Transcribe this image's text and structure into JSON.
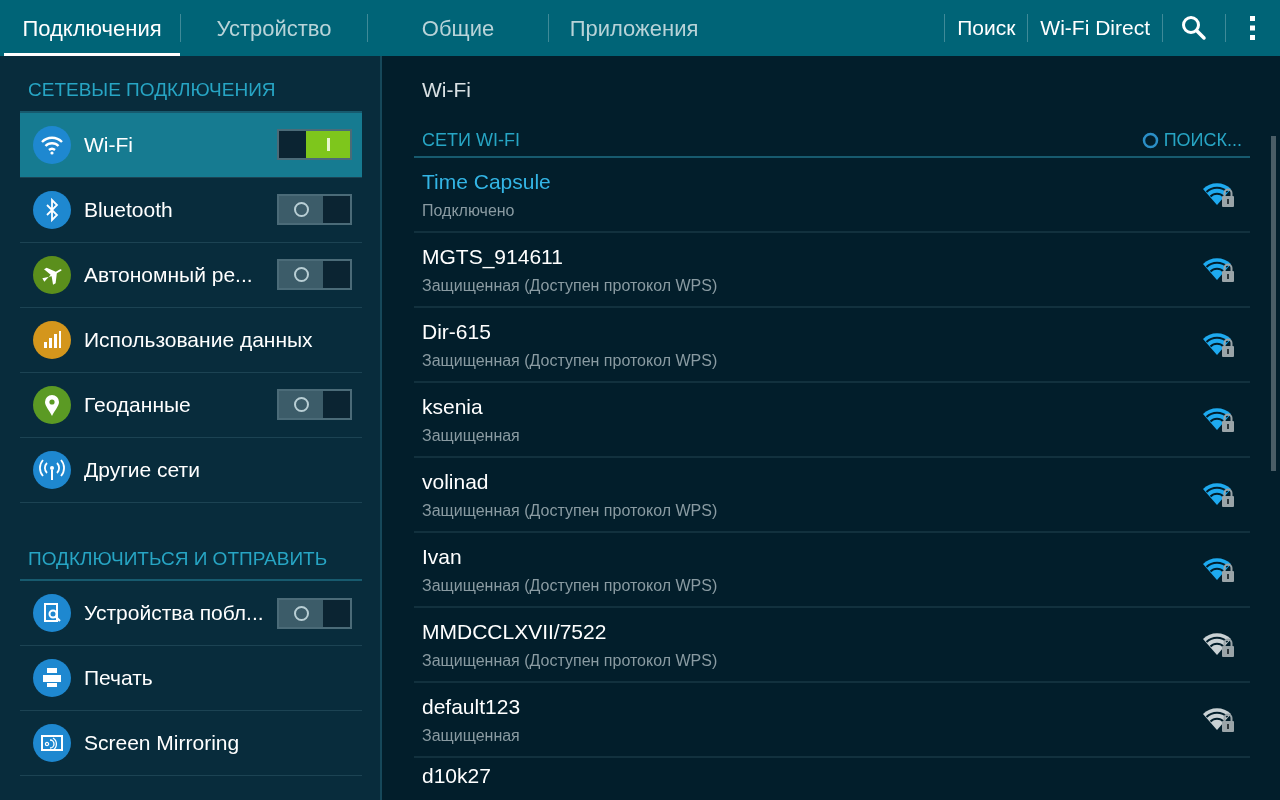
{
  "tabs": [
    {
      "label": "Подключения",
      "selected": true
    },
    {
      "label": "Устройство",
      "selected": false
    },
    {
      "label": "Общие",
      "selected": false
    },
    {
      "label": "Приложения",
      "selected": false
    }
  ],
  "actions": [
    "Поиск",
    "Wi-Fi Direct"
  ],
  "sidebar": {
    "sections": [
      {
        "title": "СЕТЕВЫЕ ПОДКЛЮЧЕНИЯ",
        "items": [
          {
            "label": "Wi-Fi",
            "kind": "wifi",
            "color": "#1e88d0",
            "selected": true,
            "toggle": true,
            "on": true
          },
          {
            "label": "Bluetooth",
            "kind": "bluetooth",
            "color": "#1e88d0",
            "selected": false,
            "toggle": true,
            "on": false
          },
          {
            "label": "Автономный ре...",
            "kind": "airplane",
            "color": "#5b8f1c",
            "selected": false,
            "toggle": true,
            "on": false
          },
          {
            "label": "Использование данных",
            "kind": "data",
            "color": "#d4961c",
            "selected": false,
            "toggle": false
          },
          {
            "label": "Геоданные",
            "kind": "location",
            "color": "#5b9a24",
            "selected": false,
            "toggle": true,
            "on": false
          },
          {
            "label": "Другие сети",
            "kind": "antenna",
            "color": "#1e88d0",
            "selected": false,
            "toggle": false
          }
        ]
      },
      {
        "title": "ПОДКЛЮЧИТЬСЯ И ОТПРАВИТЬ",
        "items": [
          {
            "label": "Устройства побл...",
            "kind": "nearby",
            "color": "#1e88d0",
            "selected": false,
            "toggle": true,
            "on": false
          },
          {
            "label": "Печать",
            "kind": "printer",
            "color": "#1e88d0",
            "selected": false,
            "toggle": false
          },
          {
            "label": "Screen Mirroring",
            "kind": "mirror",
            "color": "#1e88d0",
            "selected": false,
            "toggle": false
          }
        ]
      }
    ]
  },
  "content": {
    "title": "Wi-Fi",
    "list_header": "СЕТИ WI-FI",
    "scan_status": "ПОИСК...",
    "networks": [
      {
        "name": "Time Capsule",
        "status": "Подключено",
        "connected": true,
        "kind": "strong"
      },
      {
        "name": "MGTS_914611",
        "status": "Защищенная (Доступен протокол WPS)",
        "connected": false,
        "kind": "strong"
      },
      {
        "name": "Dir-615",
        "status": "Защищенная (Доступен протокол WPS)",
        "connected": false,
        "kind": "strong"
      },
      {
        "name": "ksenia",
        "status": "Защищенная",
        "connected": false,
        "kind": "strong"
      },
      {
        "name": "volinad",
        "status": "Защищенная (Доступен протокол WPS)",
        "connected": false,
        "kind": "strong"
      },
      {
        "name": "Ivan",
        "status": "Защищенная (Доступен протокол WPS)",
        "connected": false,
        "kind": "strong"
      },
      {
        "name": "MMDCCLXVII/7522",
        "status": "Защищенная (Доступен протокол WPS)",
        "connected": false,
        "kind": "weak"
      },
      {
        "name": "default123",
        "status": "Защищенная",
        "connected": false,
        "kind": "weak"
      },
      {
        "name": "d10k27",
        "kind": "partial"
      }
    ]
  }
}
